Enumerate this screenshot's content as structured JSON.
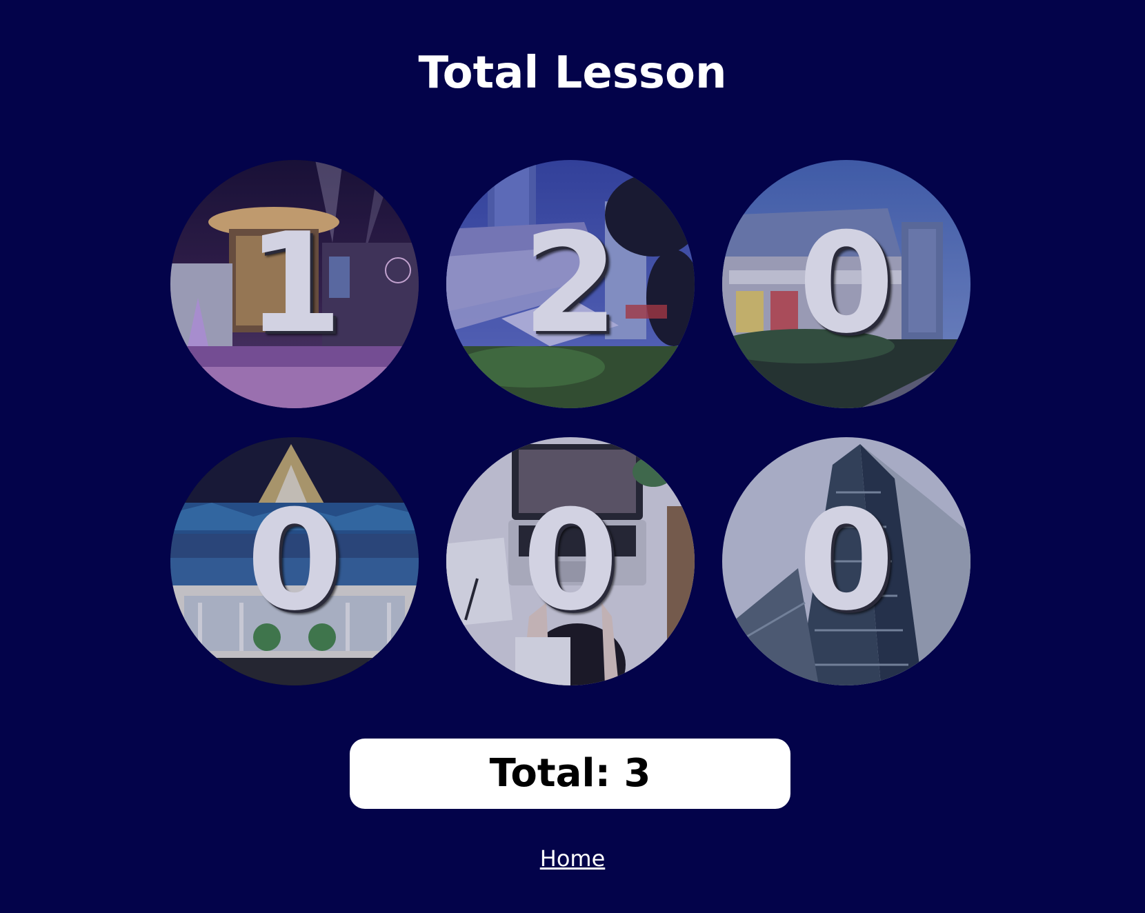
{
  "page": {
    "title": "Total Lesson",
    "background_color": "#03034a"
  },
  "digits": [
    "1",
    "2",
    "0",
    "0",
    "0",
    "0"
  ],
  "tiles": [
    {
      "digit": "1",
      "scene": "mall-at-night"
    },
    {
      "digit": "2",
      "scene": "central-world-building"
    },
    {
      "digit": "0",
      "scene": "central-plaza-building"
    },
    {
      "digit": "0",
      "scene": "iconsiam-building"
    },
    {
      "digit": "0",
      "scene": "laptop-on-desk"
    },
    {
      "digit": "0",
      "scene": "office-tower"
    }
  ],
  "total": {
    "label": "Total: 3",
    "value": 3
  },
  "nav": {
    "home_label": "Home"
  }
}
